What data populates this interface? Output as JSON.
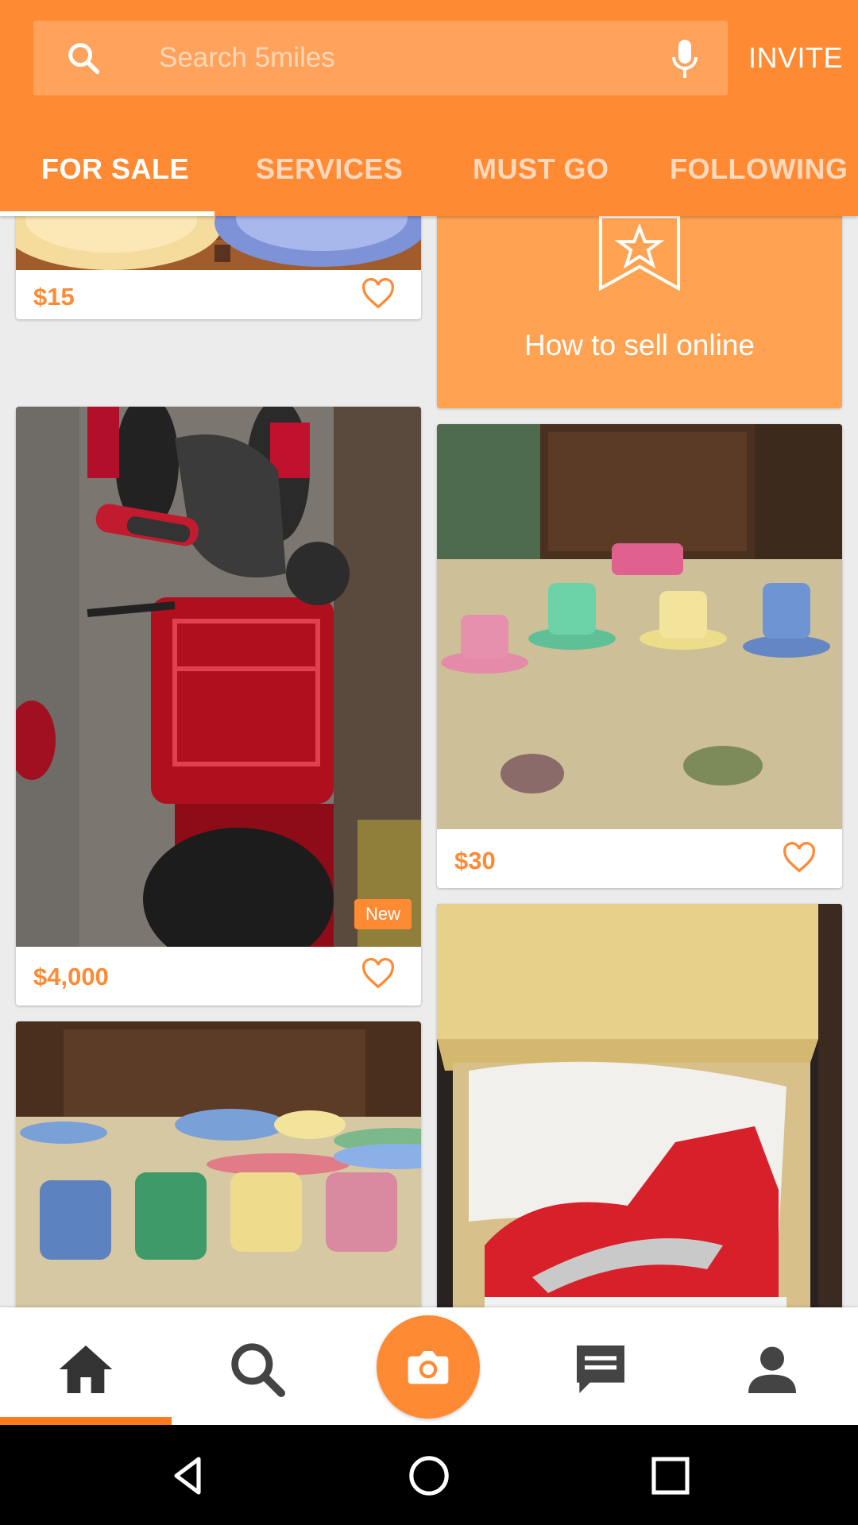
{
  "header": {
    "search_placeholder": "Search 5miles",
    "invite_label": "INVITE",
    "brand_color": "#ff8a34"
  },
  "tabs": [
    {
      "label": "FOR SALE",
      "active": true
    },
    {
      "label": "SERVICES",
      "active": false
    },
    {
      "label": "MUST GO",
      "active": false
    },
    {
      "label": "FOLLOWING",
      "active": false
    }
  ],
  "feed": {
    "promo": {
      "label": "How to sell online",
      "icon": "star-flag-icon"
    },
    "items": [
      {
        "price": "$15",
        "photo": "plates"
      },
      {
        "price": "$4,000",
        "photo": "red-scooter",
        "badge": "New"
      },
      {
        "price": "$30",
        "photo": "colorful-cups"
      },
      {
        "price": "",
        "photo": "fiesta-mugs"
      },
      {
        "price": "",
        "photo": "red-sneaker-box"
      }
    ]
  },
  "bottom_nav": [
    {
      "name": "home-icon",
      "active": true
    },
    {
      "name": "search-icon",
      "active": false
    },
    {
      "name": "camera-icon",
      "active": false
    },
    {
      "name": "chat-icon",
      "active": false
    },
    {
      "name": "profile-icon",
      "active": false
    }
  ],
  "system_nav": [
    "back-icon",
    "home-circle-icon",
    "recents-icon"
  ]
}
